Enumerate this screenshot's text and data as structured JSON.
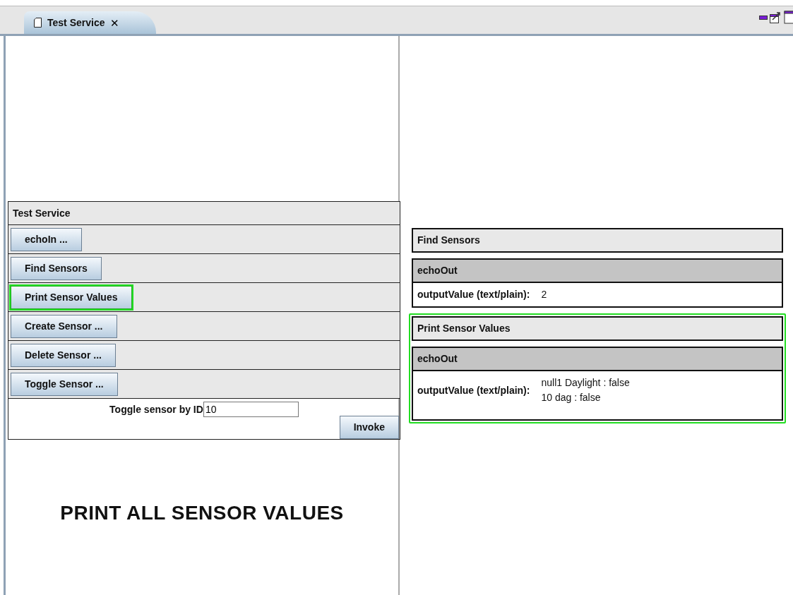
{
  "tab": {
    "title": "Test Service",
    "selected": true,
    "close": "✕"
  },
  "service": {
    "title": "Test Service",
    "operations": [
      {
        "label": "echoIn ...",
        "highlighted": false
      },
      {
        "label": "Find Sensors",
        "highlighted": false
      },
      {
        "label": "Print Sensor Values",
        "highlighted": true
      },
      {
        "label": "Create Sensor ...",
        "highlighted": false
      },
      {
        "label": "Delete Sensor ...",
        "highlighted": false
      },
      {
        "label": "Toggle Sensor ...",
        "highlighted": false
      }
    ],
    "form": {
      "label": "Toggle sensor by ID",
      "value": "10",
      "button": "Invoke"
    }
  },
  "caption": "PRINT ALL SENSOR VALUES",
  "results": [
    {
      "title": "Find Sensors",
      "highlighted": false,
      "output": {
        "name": "echoOut",
        "label": "outputValue (text/plain):",
        "lines": [
          "2"
        ]
      }
    },
    {
      "title": "Print Sensor Values",
      "highlighted": true,
      "output": {
        "name": "echoOut",
        "label": "outputValue (text/plain):",
        "lines": [
          "null1 Daylight : false",
          "10 dag : false"
        ]
      }
    }
  ]
}
